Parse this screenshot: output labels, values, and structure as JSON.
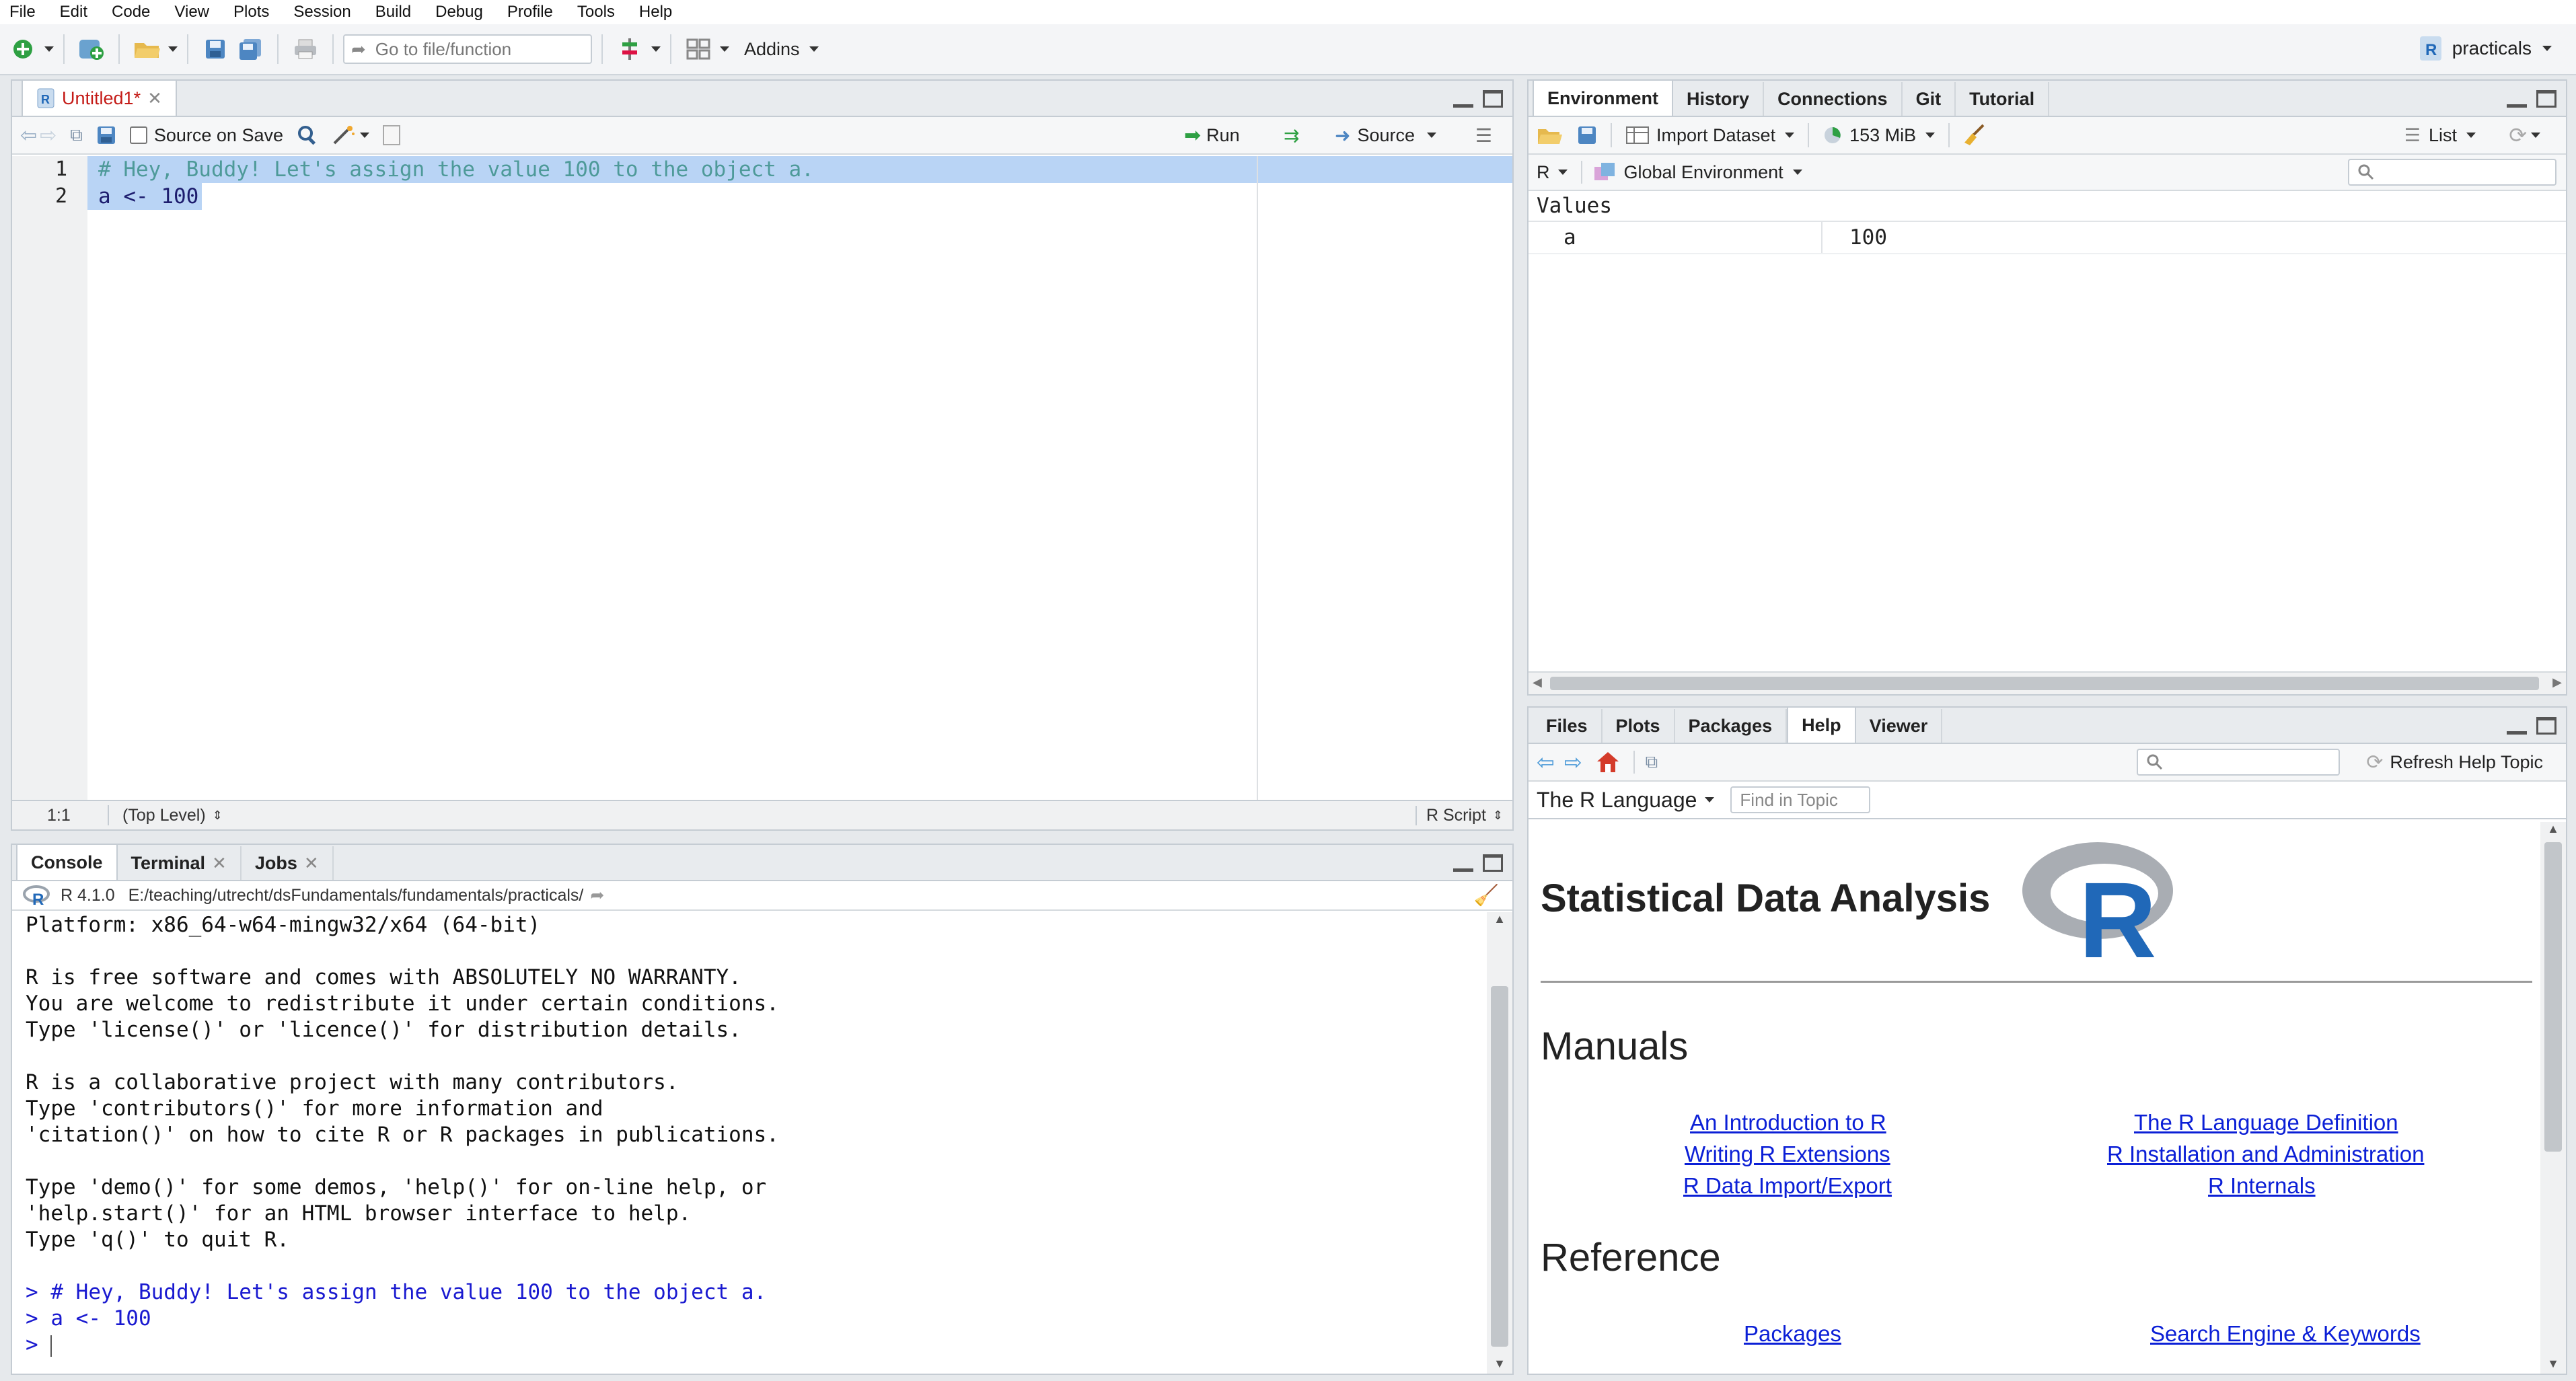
{
  "menu": [
    "File",
    "Edit",
    "Code",
    "View",
    "Plots",
    "Session",
    "Build",
    "Debug",
    "Profile",
    "Tools",
    "Help"
  ],
  "toolbar": {
    "goto_placeholder": "Go to file/function",
    "addins_label": "Addins",
    "project_label": "practicals"
  },
  "editor": {
    "tab_label": "Untitled1*",
    "source_on_save_label": "Source on Save",
    "run_label": "Run",
    "source_label": "Source",
    "line_numbers": [
      "1",
      "2"
    ],
    "lines": [
      "# Hey, Buddy! Let's assign the value 100 to the object a.",
      "a <- 100"
    ],
    "status_position": "1:1",
    "status_scope": "(Top Level)",
    "status_filetype": "R Script"
  },
  "console": {
    "tabs": [
      "Console",
      "Terminal",
      "Jobs"
    ],
    "r_version": "R 4.1.0",
    "path": "E:/teaching/utrecht/dsFundamentals/fundamentals/practicals/",
    "output_lines": [
      "Platform: x86_64-w64-mingw32/x64 (64-bit)",
      "",
      "R is free software and comes with ABSOLUTELY NO WARRANTY.",
      "You are welcome to redistribute it under certain conditions.",
      "Type 'license()' or 'licence()' for distribution details.",
      "",
      "R is a collaborative project with many contributors.",
      "Type 'contributors()' for more information and",
      "'citation()' on how to cite R or R packages in publications.",
      "",
      "Type 'demo()' for some demos, 'help()' for on-line help, or",
      "'help.start()' for an HTML browser interface to help.",
      "Type 'q()' to quit R.",
      ""
    ],
    "input_lines": [
      "> # Hey, Buddy! Let's assign the value 100 to the object a.",
      "> a <- 100",
      "> "
    ]
  },
  "environment": {
    "tabs": [
      "Environment",
      "History",
      "Connections",
      "Git",
      "Tutorial"
    ],
    "import_label": "Import Dataset",
    "memory_label": "153 MiB",
    "view_label": "List",
    "language_label": "R",
    "scope_label": "Global Environment",
    "section_label": "Values",
    "rows": [
      {
        "name": "a",
        "value": "100"
      }
    ]
  },
  "help": {
    "tabs": [
      "Files",
      "Plots",
      "Packages",
      "Help",
      "Viewer"
    ],
    "refresh_label": "Refresh Help Topic",
    "topic_label": "The R Language",
    "find_placeholder": "Find in Topic",
    "title": "Statistical Data Analysis",
    "logo_letter": "R",
    "manuals_heading": "Manuals",
    "manual_links": [
      "An Introduction to R",
      "The R Language Definition",
      "Writing R Extensions",
      "R Installation and Administration",
      "R Data Import/Export",
      "R Internals"
    ],
    "reference_heading": "Reference",
    "reference_links": [
      "Packages",
      "Search Engine & Keywords"
    ]
  },
  "colors": {
    "comment": "#4e9a99",
    "selection": "#b9d4f5",
    "link": "#0b1fd6",
    "console_input": "#1a1ad0",
    "r_logo_blue": "#2068b8"
  }
}
